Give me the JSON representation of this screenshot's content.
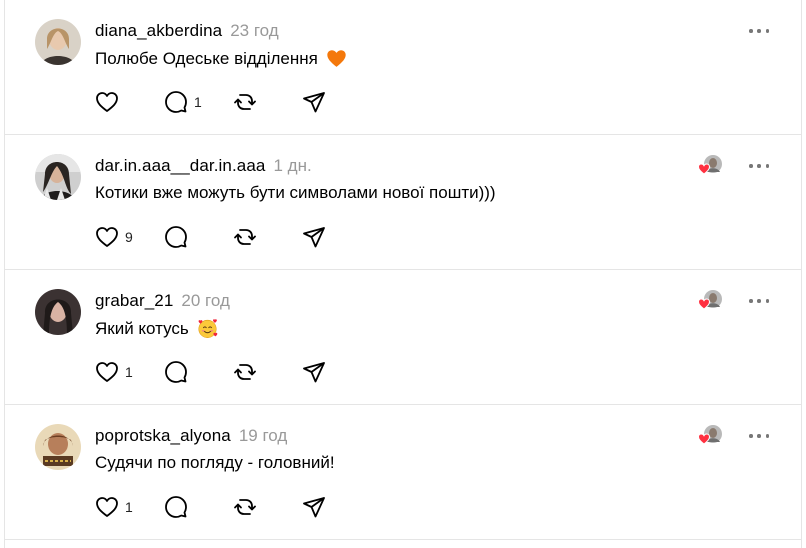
{
  "posts": [
    {
      "username": "diana_akberdina",
      "time": "23 год",
      "text": "Полюбе Одеське відділення",
      "emoji": "orange-heart",
      "likes": "",
      "replies": "1",
      "liked_by_author": false
    },
    {
      "username": "dar.in.aaa__dar.in.aaa",
      "time": "1 дн.",
      "text": "Котики вже можуть бути символами нової пошти)))",
      "emoji": "",
      "likes": "9",
      "replies": "",
      "liked_by_author": true
    },
    {
      "username": "grabar_21",
      "time": "20 год",
      "text": "Який котусь",
      "emoji": "smiling-face-with-hearts",
      "likes": "1",
      "replies": "",
      "liked_by_author": true
    },
    {
      "username": "poprotska_alyona",
      "time": "19 год",
      "text": "Судячи по погляду - головний!",
      "emoji": "",
      "likes": "1",
      "replies": "",
      "liked_by_author": true
    }
  ],
  "colors": {
    "text": "#000000",
    "muted": "#999999",
    "divider": "#e5e5e5",
    "heart_red": "#ff3040",
    "orange_heart": "#f4780b"
  }
}
